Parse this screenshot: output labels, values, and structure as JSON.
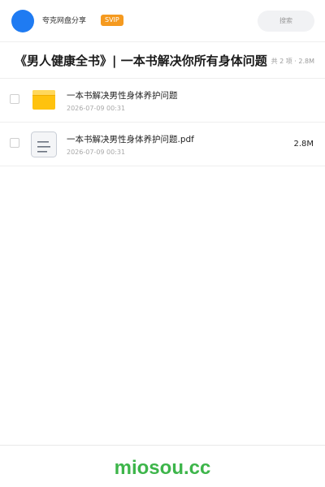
{
  "header": {
    "share_name": "夸克网盘分享",
    "badge": "SVIP",
    "search_placeholder": "搜索",
    "avatar_color": "#1f7bf2",
    "badge_color": "#f59a1f"
  },
  "folder": {
    "title": "《男人健康全书》| 一本书解决你所有身体问题",
    "summary": "共 2 项 · 2.8M"
  },
  "files": [
    {
      "icon": "folder-icon",
      "name": "一本书解决男性身体养护问题",
      "date": "2026-07-09 00:31",
      "size": ""
    },
    {
      "icon": "document-icon",
      "name": "一本书解决男性身体养护问题.pdf",
      "date": "2026-07-09 00:31",
      "size": "2.8M"
    }
  ],
  "footer": {
    "site": "miosou.cc",
    "site_color": "#3db54a"
  }
}
